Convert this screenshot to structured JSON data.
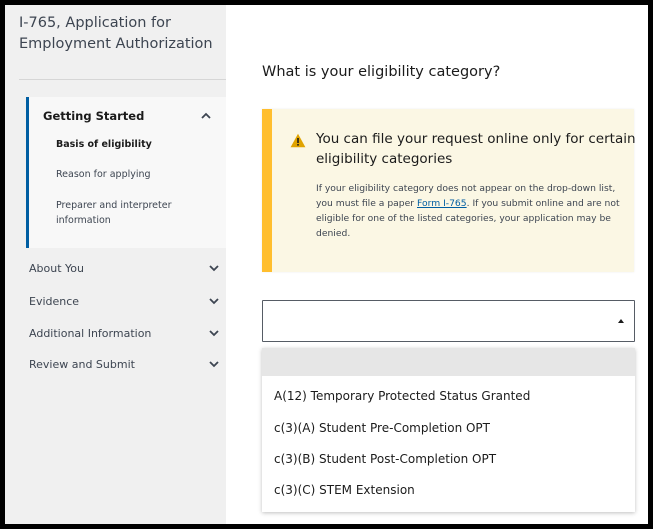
{
  "app": {
    "title": "I-765, Application for Employment Authorization"
  },
  "sidebar": {
    "active_group": {
      "label": "Getting Started",
      "items": [
        {
          "label": "Basis of eligibility",
          "active": true
        },
        {
          "label": "Reason for applying",
          "active": false
        },
        {
          "label": "Preparer and interpreter information",
          "active": false
        }
      ]
    },
    "groups": [
      {
        "label": "About You"
      },
      {
        "label": "Evidence"
      },
      {
        "label": "Additional Information"
      },
      {
        "label": "Review and Submit"
      }
    ]
  },
  "main": {
    "question": "What is your eligibility category?",
    "alert": {
      "heading": "You can file your request online only for certain eligibility categories",
      "body_before_link": "If your eligibility category does not appear on the drop-down list, you must file a paper ",
      "link_text": "Form I-765",
      "body_after_link": ". If you submit online and are not eligible for one of the listed categories, your application may be denied."
    },
    "select": {
      "value": "",
      "options": [
        "",
        "A(12) Temporary Protected Status Granted",
        "c(3)(A) Student Pre-Completion OPT",
        "c(3)(B) Student Post-Completion OPT",
        "c(3)(C) STEM Extension"
      ]
    }
  },
  "colors": {
    "accent": "#005ea2",
    "warning": "#ffbe2e",
    "sidebar_bg": "#f0f0f0"
  },
  "icons": {
    "alert": "warning-triangle-icon",
    "expand": "chevron-down-icon",
    "collapse": "chevron-up-icon"
  }
}
